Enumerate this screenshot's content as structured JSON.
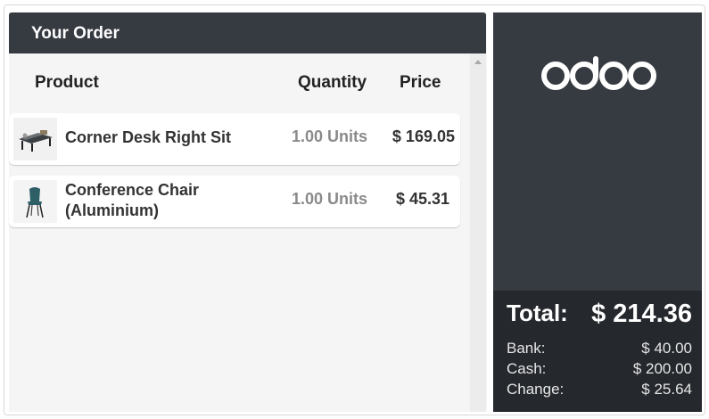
{
  "order": {
    "title": "Your Order",
    "columns": {
      "product": "Product",
      "quantity": "Quantity",
      "price": "Price"
    },
    "lines": [
      {
        "product": "Corner Desk Right Sit",
        "quantity": "1.00 Units",
        "price": "$ 169.05",
        "icon": "corner-desk-thumbnail"
      },
      {
        "product": "Conference Chair (Aluminium)",
        "quantity": "1.00 Units",
        "price": "$ 45.31",
        "icon": "conference-chair-thumbnail"
      }
    ]
  },
  "brand": {
    "logo_text": "odoo",
    "panel_color": "#363a41",
    "totals_color": "#25282d"
  },
  "totals": {
    "label": "Total:",
    "value": "$ 214.36",
    "payments": [
      {
        "label": "Bank:",
        "value": "$ 40.00"
      },
      {
        "label": "Cash:",
        "value": "$ 200.00"
      },
      {
        "label": "Change:",
        "value": "$ 25.64"
      }
    ]
  }
}
